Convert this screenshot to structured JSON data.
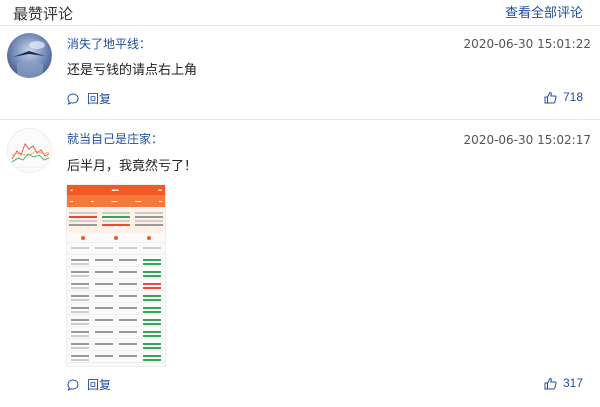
{
  "header": {
    "title": "最赞评论",
    "view_all_link": "查看全部评论"
  },
  "comments": [
    {
      "username": "消失了地平线：",
      "timestamp": "2020-06-30 15:01:22",
      "content": "还是亏钱的请点右上角",
      "reply_label": "回复",
      "like_count": "718",
      "avatar_icon": "sky-photo-avatar"
    },
    {
      "username": "就当自己是庄家：",
      "timestamp": "2020-06-30 15:02:17",
      "content": "后半月，我竟然亏了！",
      "reply_label": "回复",
      "like_count": "317",
      "avatar_icon": "stock-chart-avatar",
      "attachment_icon": "trading-app-screenshot"
    }
  ],
  "colors": {
    "link_blue": "#1f4e9c",
    "brand_orange": "#f15a22",
    "divider": "#e7e7e7"
  }
}
